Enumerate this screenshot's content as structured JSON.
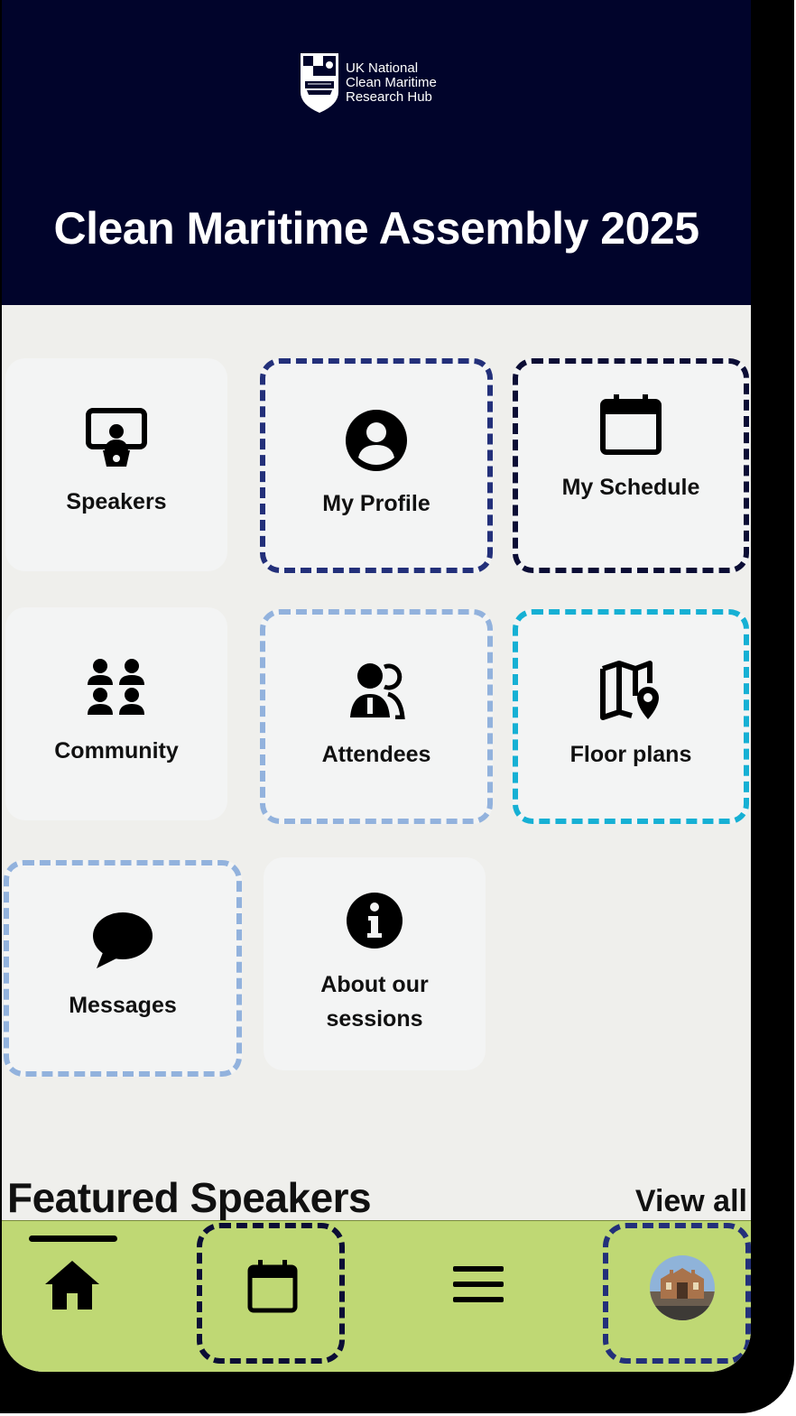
{
  "header": {
    "logo_lines": [
      "UK National",
      "Clean Maritime",
      "Research Hub"
    ],
    "title": "Clean Maritime Assembly 2025"
  },
  "tiles": [
    {
      "label": "Speakers",
      "icon": "presenter-icon"
    },
    {
      "label": "My Profile",
      "icon": "user-circle-icon"
    },
    {
      "label": "My Schedule",
      "icon": "calendar-icon"
    },
    {
      "label": "Community",
      "icon": "people-group-icon"
    },
    {
      "label": "Attendees",
      "icon": "attendees-icon"
    },
    {
      "label": "Floor plans",
      "icon": "map-pin-icon"
    },
    {
      "label": "Messages",
      "icon": "chat-bubble-icon"
    },
    {
      "label": "About our sessions",
      "icon": "info-icon"
    }
  ],
  "featured": {
    "heading": "Featured Speakers",
    "view_all": "View all"
  },
  "bottom_nav": [
    {
      "icon": "home-icon",
      "active": true
    },
    {
      "icon": "calendar-icon"
    },
    {
      "icon": "menu-icon"
    },
    {
      "icon": "avatar"
    }
  ],
  "colors": {
    "header_bg": "#01042b",
    "page_bg": "#efefec",
    "tile_bg": "#f3f4f4",
    "nav_bg": "#bfd874",
    "dash_navy": "#23307a",
    "dash_dark": "#0b0d35",
    "dash_light": "#92b2dd",
    "dash_cyan": "#16b0d4"
  }
}
